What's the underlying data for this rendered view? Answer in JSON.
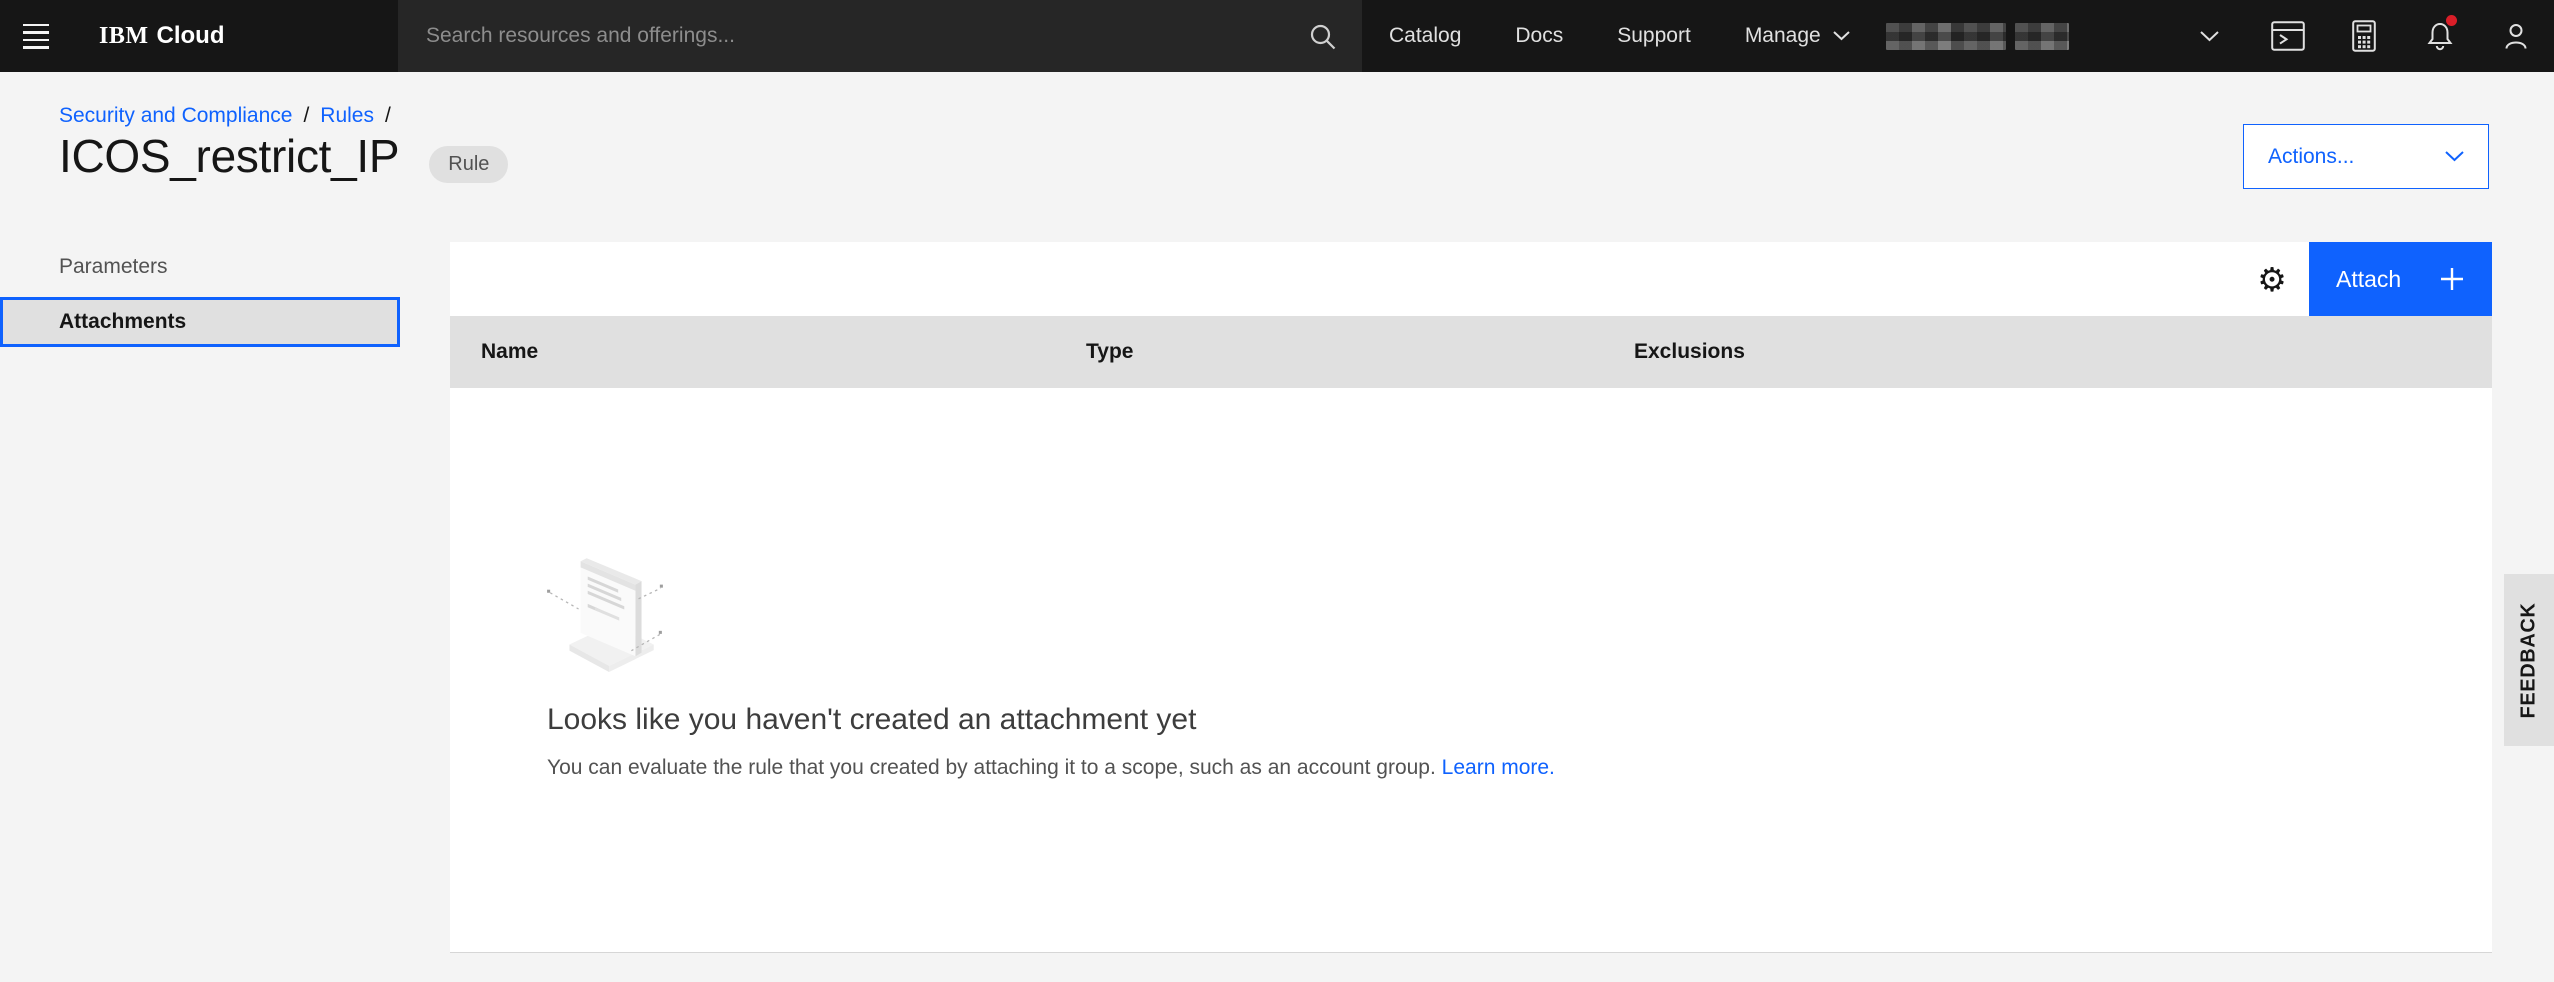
{
  "colors": {
    "accent": "#0f62fe",
    "header_bg": "#161616",
    "page_bg": "#f4f4f4",
    "card_bg": "#ffffff",
    "row_gray": "#e0e0e0",
    "notification_dot": "#da1e28",
    "link": "#0f62fe"
  },
  "header": {
    "brand_company": "IBM",
    "brand_product": "Cloud",
    "search_placeholder": "Search resources and offerings...",
    "links": [
      "Catalog",
      "Docs",
      "Support"
    ],
    "manage_label": "Manage",
    "account": {
      "redacted": true
    },
    "notification_unread": true
  },
  "breadcrumb": {
    "items": [
      "Security and Compliance",
      "Rules"
    ],
    "separator": "/"
  },
  "page": {
    "title": "ICOS_restrict_IP",
    "tag": "Rule"
  },
  "actions": {
    "label": "Actions..."
  },
  "sidenav": {
    "items": [
      {
        "label": "Parameters",
        "selected": false
      },
      {
        "label": "Attachments",
        "selected": true
      }
    ]
  },
  "attachments_table": {
    "columns": [
      "Name",
      "Type",
      "Exclusions"
    ],
    "rows": [],
    "attach_button": "Attach"
  },
  "empty_state": {
    "heading": "Looks like you haven't created an attachment yet",
    "body": "You can evaluate the rule that you created by attaching it to a scope, such as an account group.",
    "link": "Learn more."
  },
  "feedback": {
    "label": "FEEDBACK"
  },
  "icons": {
    "gear_glyph": "⚙"
  }
}
